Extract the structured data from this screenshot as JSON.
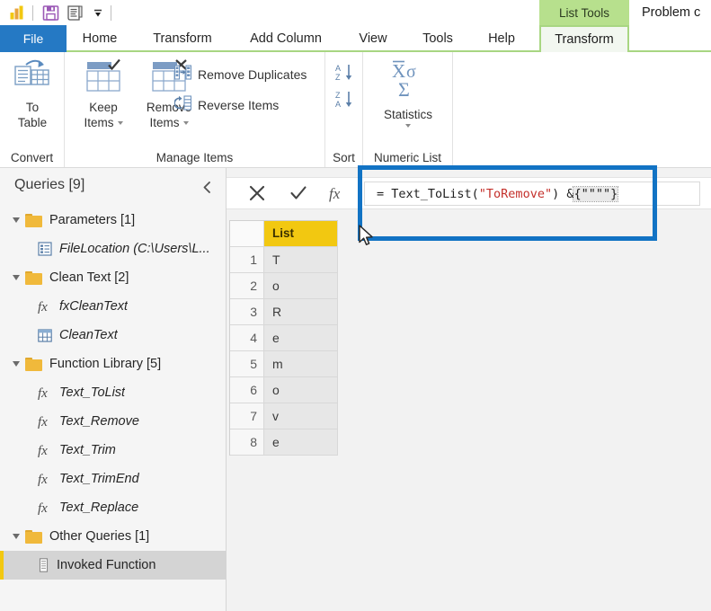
{
  "quick_access": {
    "items": [
      {
        "name": "powerbi-logo-icon",
        "label": "Power BI"
      },
      {
        "name": "save-icon",
        "label": "Save"
      },
      {
        "name": "advanced-editor-icon",
        "label": "Advanced Editor"
      },
      {
        "name": "customize-quick-access-toolbar-icon",
        "label": "Customize Quick Access Toolbar"
      }
    ]
  },
  "contextual": {
    "banner_label": "List Tools",
    "document_title": "Problem c"
  },
  "ribbon_tabs": [
    {
      "label": "File",
      "type": "file"
    },
    {
      "label": "Home",
      "type": "normal"
    },
    {
      "label": "Transform",
      "type": "normal"
    },
    {
      "label": "Add Column",
      "type": "normal"
    },
    {
      "label": "View",
      "type": "normal"
    },
    {
      "label": "Tools",
      "type": "normal"
    },
    {
      "label": "Help",
      "type": "normal"
    },
    {
      "label": "Transform",
      "type": "contextual-active"
    }
  ],
  "ribbon": {
    "groups": [
      {
        "label": "Convert",
        "buttons": [
          {
            "label": "To\nTable",
            "line1": "To",
            "line2": "Table",
            "icon": "to-table-icon"
          }
        ]
      },
      {
        "label": "Manage Items",
        "buttons": [
          {
            "line1": "Keep",
            "line2": "Items",
            "icon": "keep-items-icon",
            "has_caret": true
          },
          {
            "line1": "Remove",
            "line2": "Items",
            "icon": "remove-items-icon",
            "has_caret": true
          }
        ],
        "small_buttons": [
          {
            "label": "Remove Duplicates",
            "icon": "remove-duplicates-icon"
          },
          {
            "label": "Reverse Items",
            "icon": "reverse-items-icon"
          }
        ]
      },
      {
        "label": "Sort",
        "small_buttons": [
          {
            "label": "",
            "icon": "sort-ascending-icon"
          },
          {
            "label": "",
            "icon": "sort-descending-icon"
          }
        ]
      },
      {
        "label": "Numeric List",
        "buttons": [
          {
            "line1": "Statistics",
            "line2": "",
            "icon": "statistics-icon",
            "has_caret": true
          }
        ]
      }
    ]
  },
  "queries_pane": {
    "title": "Queries [9]",
    "collapse_icon": "chevron-left-icon",
    "tree": [
      {
        "label": "Parameters [1]",
        "icon": "folder-icon",
        "level": 0,
        "expanded": true,
        "selected": false,
        "italic": false
      },
      {
        "label": "FileLocation (C:\\Users\\L...",
        "icon": "parameter-icon",
        "level": 1,
        "expanded": null,
        "selected": false,
        "italic": true
      },
      {
        "label": "Clean Text [2]",
        "icon": "folder-icon",
        "level": 0,
        "expanded": true,
        "selected": false,
        "italic": false
      },
      {
        "label": "fxCleanText",
        "icon": "function-icon",
        "level": 1,
        "expanded": null,
        "selected": false,
        "italic": true
      },
      {
        "label": "CleanText",
        "icon": "table-icon",
        "level": 1,
        "expanded": null,
        "selected": false,
        "italic": true
      },
      {
        "label": "Function Library [5]",
        "icon": "folder-icon",
        "level": 0,
        "expanded": true,
        "selected": false,
        "italic": false
      },
      {
        "label": "Text_ToList",
        "icon": "function-icon",
        "level": 1,
        "expanded": null,
        "selected": false,
        "italic": true
      },
      {
        "label": "Text_Remove",
        "icon": "function-icon",
        "level": 1,
        "expanded": null,
        "selected": false,
        "italic": true
      },
      {
        "label": "Text_Trim",
        "icon": "function-icon",
        "level": 1,
        "expanded": null,
        "selected": false,
        "italic": true
      },
      {
        "label": "Text_TrimEnd",
        "icon": "function-icon",
        "level": 1,
        "expanded": null,
        "selected": false,
        "italic": true
      },
      {
        "label": "Text_Replace",
        "icon": "function-icon",
        "level": 1,
        "expanded": null,
        "selected": false,
        "italic": true
      },
      {
        "label": "Other Queries [1]",
        "icon": "folder-icon",
        "level": 0,
        "expanded": true,
        "selected": false,
        "italic": false
      },
      {
        "label": "Invoked Function",
        "icon": "list-icon",
        "level": 1,
        "expanded": null,
        "selected": true,
        "italic": false
      }
    ]
  },
  "formula_bar": {
    "cancel_icon": "cancel-x-icon",
    "confirm_icon": "confirm-check-icon",
    "fx_icon": "fx-icon",
    "value_full": "= Text_ToList(\"ToRemove\") & {\"\\\"\\\"\"}",
    "tokens": {
      "prefix": "= Text_ToList(",
      "string_arg": "\"ToRemove\"",
      "middle": ") & ",
      "selected": "{\"\"\"\"}"
    }
  },
  "grid": {
    "column_headers": [
      "",
      "List"
    ],
    "rows": [
      {
        "index": "1",
        "value": "T"
      },
      {
        "index": "2",
        "value": "o"
      },
      {
        "index": "3",
        "value": "R"
      },
      {
        "index": "4",
        "value": "e"
      },
      {
        "index": "5",
        "value": "m"
      },
      {
        "index": "6",
        "value": "o"
      },
      {
        "index": "7",
        "value": "v"
      },
      {
        "index": "8",
        "value": "e"
      }
    ]
  },
  "annotation": {
    "shape": "rectangle-highlight",
    "color": "#1273C4"
  },
  "colors": {
    "file_tab": "#2579C4",
    "contextual_green": "#B7E08D",
    "ribbon_underline": "#A8D682",
    "column_header_gold": "#F2C811",
    "annotation_blue": "#1273C4",
    "selection_gray": "#D4D4D4"
  }
}
